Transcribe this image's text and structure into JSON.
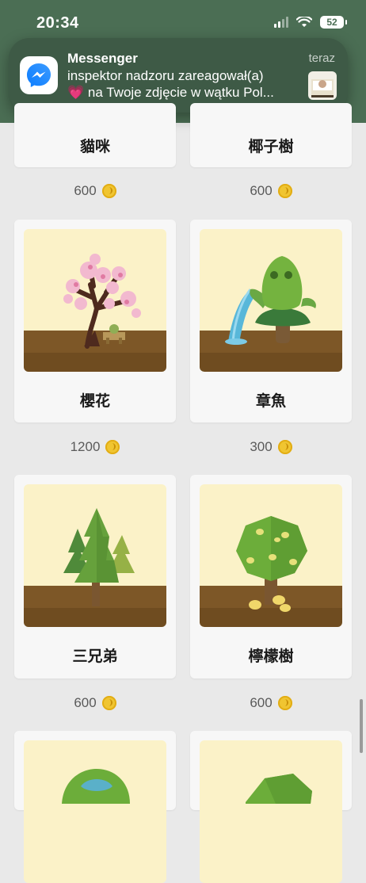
{
  "status": {
    "time": "20:34",
    "battery": "52"
  },
  "notification": {
    "app": "Messenger",
    "time": "teraz",
    "line1": "inspektor nadzoru zareagował(a)",
    "line2": "💗 na Twoje zdjęcie w wątku Pol..."
  },
  "trees": [
    {
      "name": "貓咪",
      "price": "600"
    },
    {
      "name": "椰子樹",
      "price": "600"
    },
    {
      "name": "櫻花",
      "price": "1200"
    },
    {
      "name": "章魚",
      "price": "300"
    },
    {
      "name": "三兄弟",
      "price": "600"
    },
    {
      "name": "檸檬樹",
      "price": "600"
    }
  ],
  "colors": {
    "header": "#4b6e54",
    "coin": "#f0c531",
    "art_bg": "#fbf2c8"
  }
}
